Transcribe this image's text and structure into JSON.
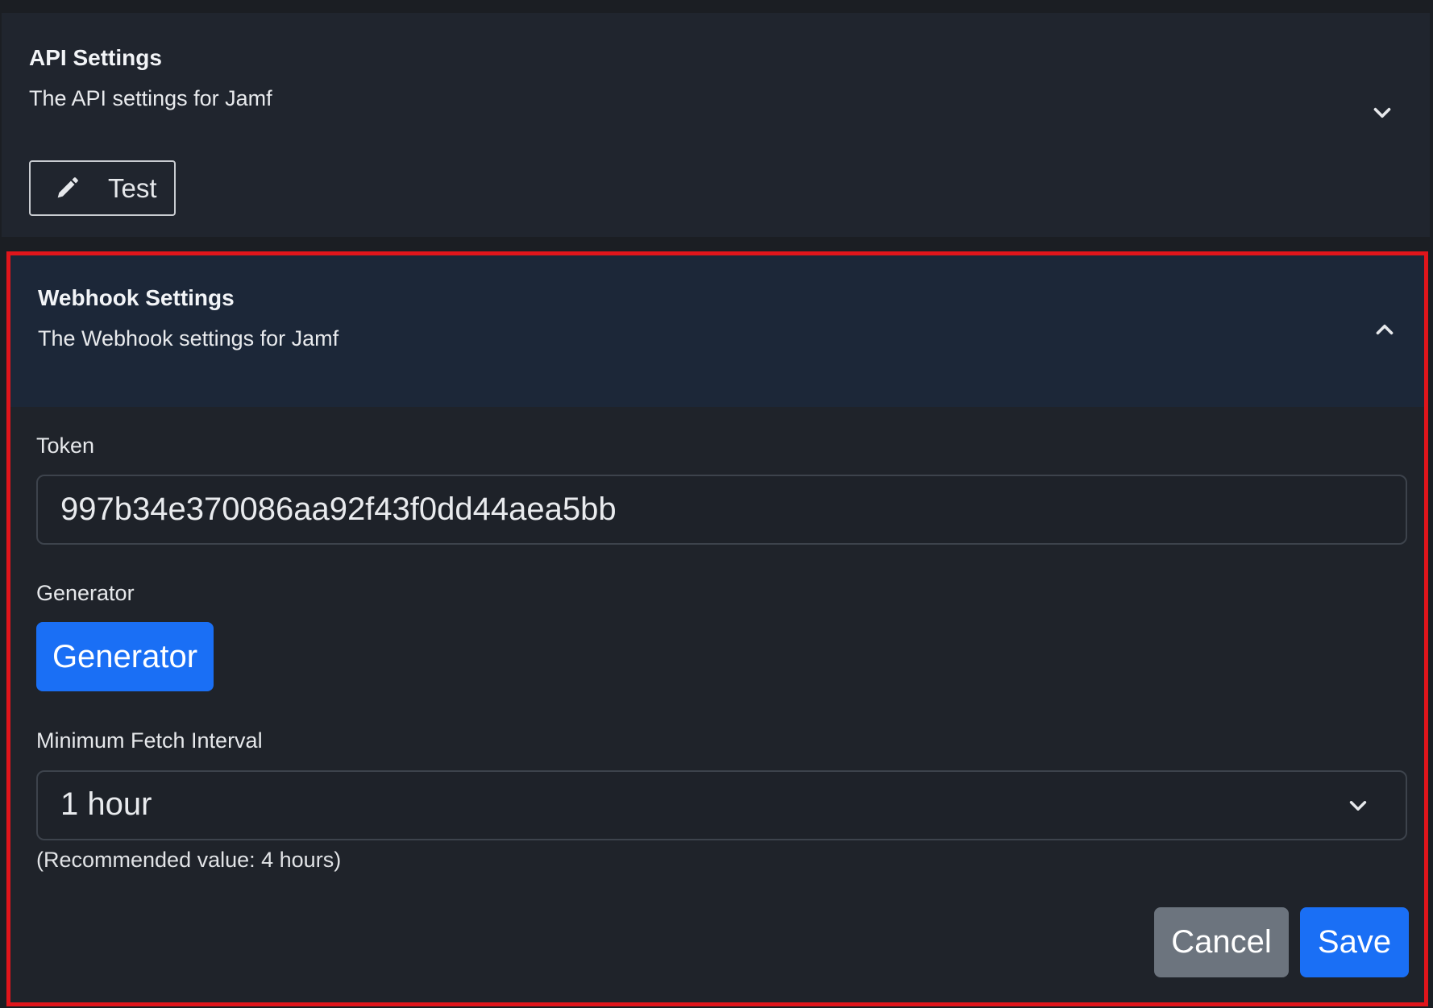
{
  "api_settings": {
    "title": "API Settings",
    "description": "The API settings for Jamf",
    "test_button_label": "Test",
    "test_icon": "pencil-icon",
    "toggle_icon": "chevron-down-icon"
  },
  "webhook_settings": {
    "title": "Webhook Settings",
    "description": "The Webhook settings for Jamf",
    "toggle_icon": "chevron-up-icon",
    "token": {
      "label": "Token",
      "value": "997b34e370086aa92f43f0dd44aea5bb"
    },
    "generator": {
      "label": "Generator",
      "button_label": "Generator"
    },
    "min_fetch_interval": {
      "label": "Minimum Fetch Interval",
      "selected": "1 hour",
      "hint": "(Recommended value: 4 hours)"
    },
    "actions": {
      "cancel_label": "Cancel",
      "save_label": "Save"
    }
  },
  "colors": {
    "accent_blue": "#1a6ff5",
    "highlight_border": "#e0151b",
    "cancel_gray": "#6c747e"
  }
}
